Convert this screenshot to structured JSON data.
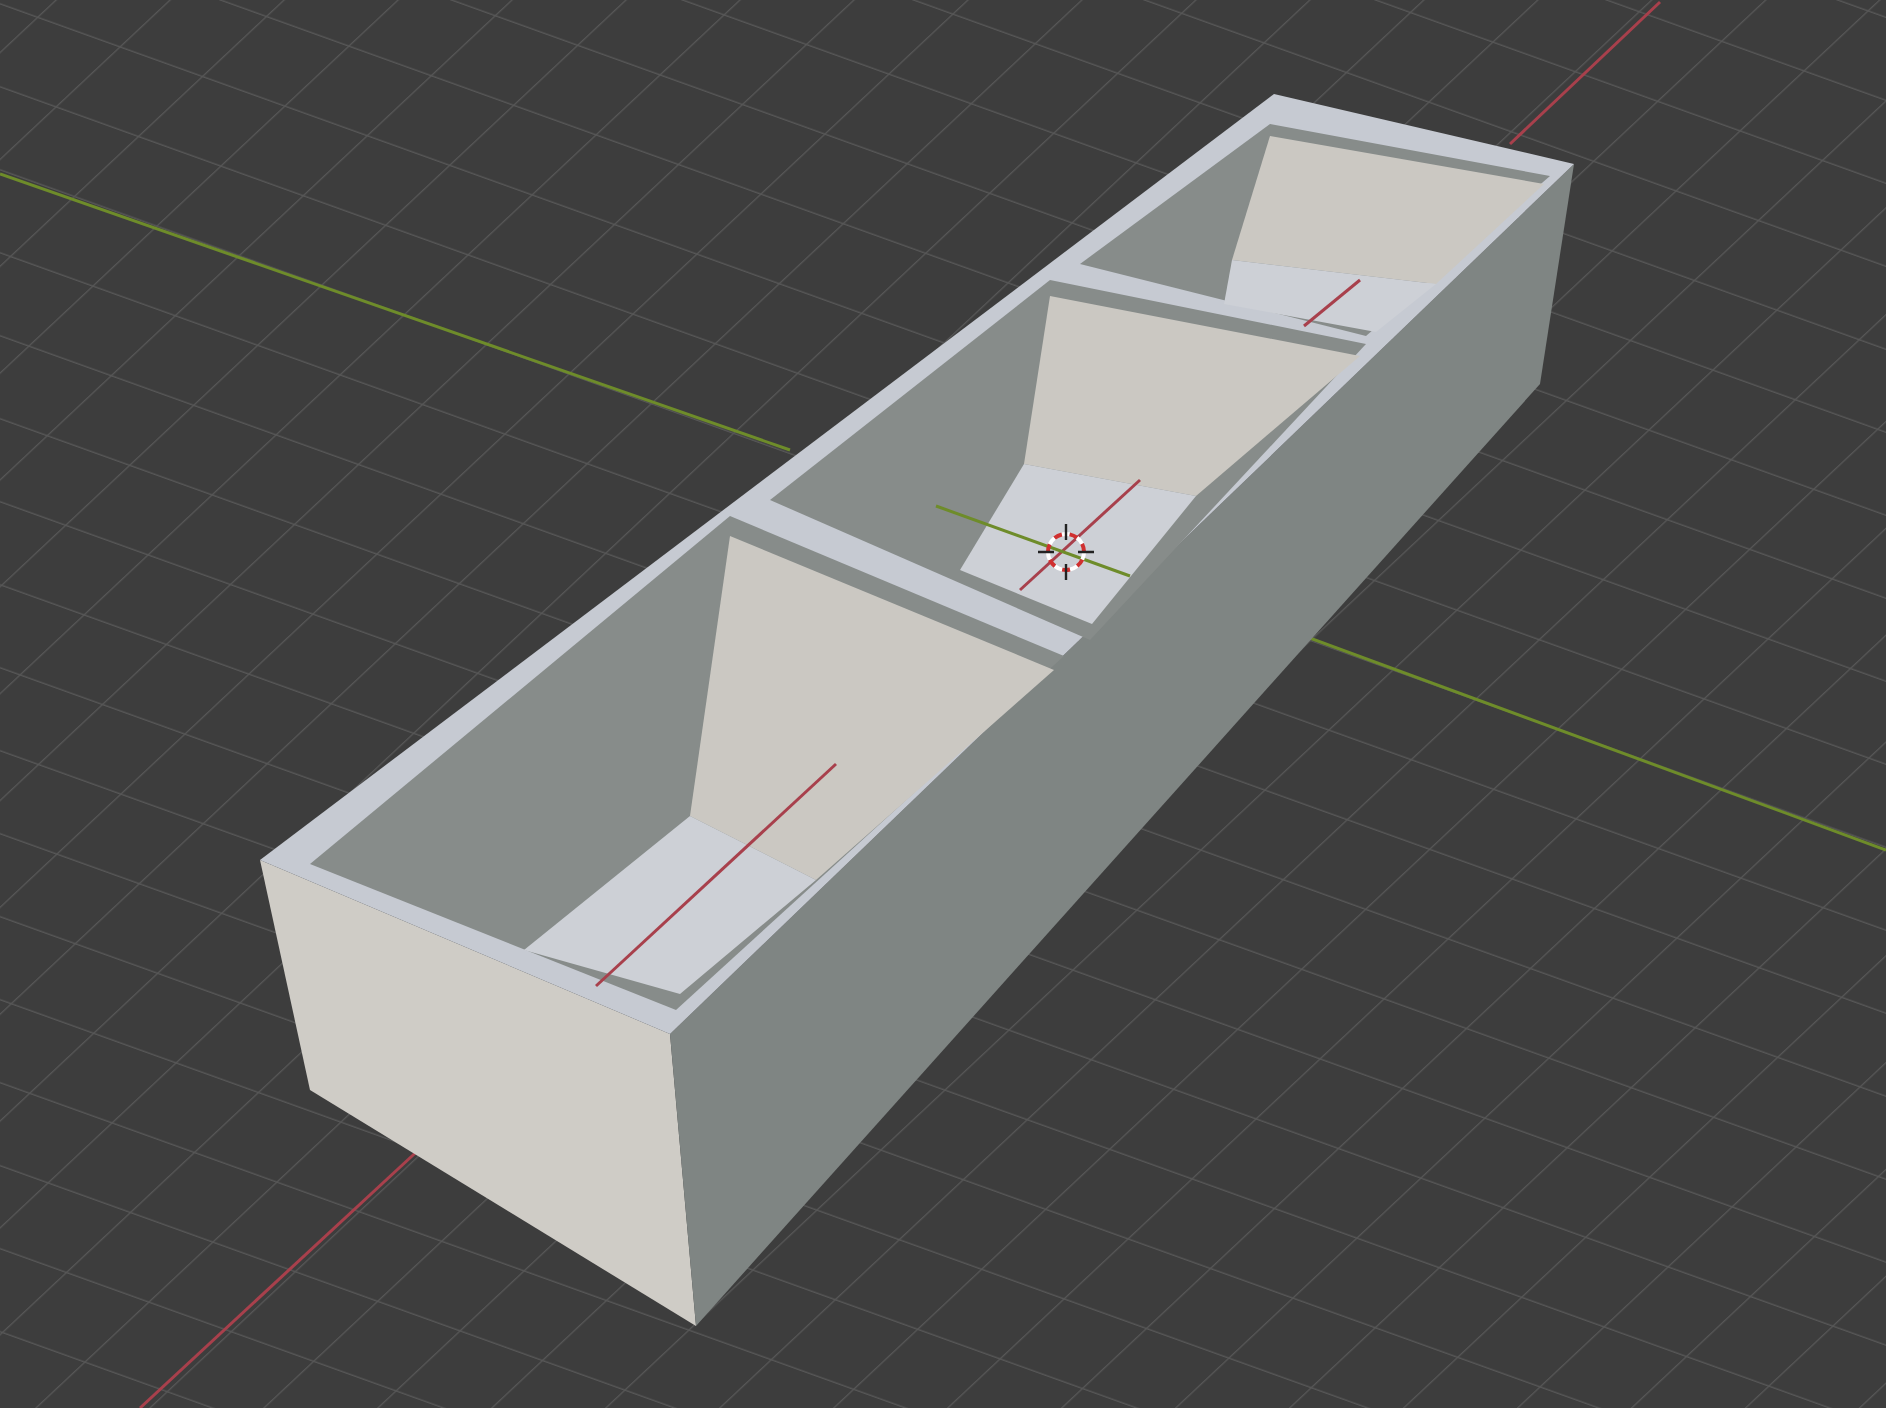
{
  "viewport": {
    "grid_visible": true,
    "axes_visible": true,
    "cursor_visible": true
  }
}
